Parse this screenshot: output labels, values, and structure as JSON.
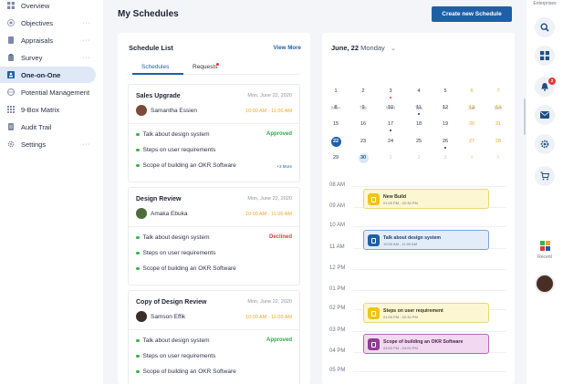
{
  "sidebar": {
    "items": [
      {
        "label": "Overview",
        "icon": "grid-icon",
        "has_menu": false
      },
      {
        "label": "Objectives",
        "icon": "target-icon",
        "has_menu": true
      },
      {
        "label": "Appraisals",
        "icon": "document-icon",
        "has_menu": true
      },
      {
        "label": "Survey",
        "icon": "clipboard-icon",
        "has_menu": true
      },
      {
        "label": "One-on-One",
        "icon": "person-card-icon",
        "has_menu": false,
        "active": true
      },
      {
        "label": "Potential Management",
        "icon": "globe-icon",
        "has_menu": false
      },
      {
        "label": "9-Box Matrix",
        "icon": "matrix-icon",
        "has_menu": false
      },
      {
        "label": "Audit Trail",
        "icon": "list-icon",
        "has_menu": false
      },
      {
        "label": "Settings",
        "icon": "gear-icon",
        "has_menu": true
      }
    ],
    "menu_glyph": "···"
  },
  "header": {
    "title": "My Schedules",
    "create_button": "Create new Schedule"
  },
  "schedule_list": {
    "title": "Schedule List",
    "view_more": "View More",
    "tabs": [
      "Schedules",
      "Requests"
    ],
    "cards": [
      {
        "title": "Sales Upgrade",
        "date": "Mon, June 22, 2020",
        "person": "Samantha Essien",
        "time": "10:00 AM - 11:00 AM",
        "points": [
          "Talk about design system",
          "Steps on user requirements",
          "Scope of building an OKR Software"
        ],
        "status": "Approved",
        "more": "+3 More"
      },
      {
        "title": "Design Review",
        "date": "Mon, June 22, 2020",
        "person": "Amaka Ebuka",
        "time": "10:00 AM - 11:00 AM",
        "points": [
          "Talk about design system",
          "Steps on user requirements",
          "Scope of building an OKR Software"
        ],
        "status": "Declined"
      },
      {
        "title": "Copy of Design Review",
        "date": "Mon, June 22, 2020",
        "person": "Samson Effik",
        "time": "10:00 AM - 11:00 AM",
        "points": [
          "Talk about design system",
          "Steps on user requirements",
          "Scope of building an OKR Software"
        ],
        "status": "Approved"
      }
    ],
    "colors": {
      "approved": "#2fa84f",
      "declined": "#e23b3b",
      "time": "#f5a524"
    }
  },
  "calendar": {
    "month_day": "June, 22",
    "weekday": "Monday",
    "weekdays": [
      "Mon",
      "Tue",
      "Wed",
      "Thu",
      "Fri",
      "Sat",
      "Sun"
    ],
    "weeks": [
      [
        "1",
        "2",
        "3",
        "4",
        "5",
        "6",
        "7"
      ],
      [
        "8",
        "9",
        "10",
        "11",
        "12",
        "13",
        "14"
      ],
      [
        "15",
        "16",
        "17",
        "18",
        "19",
        "20",
        "21"
      ],
      [
        "22",
        "23",
        "24",
        "25",
        "26",
        "27",
        "28"
      ],
      [
        "29",
        "30",
        "1",
        "2",
        "3",
        "4",
        "5"
      ]
    ],
    "selected_day": "22",
    "highlight_day": "30",
    "hours": [
      "08 AM",
      "09 AM",
      "10 AM",
      "11 AM",
      "12 PM",
      "01 PM",
      "02 PM",
      "03 PM",
      "04 PM",
      "05 PM"
    ],
    "events": [
      {
        "title": "New Build",
        "time": "01:00 PM - 02:30 PM",
        "color": "yellow"
      },
      {
        "title": "Talk about design system",
        "time": "10:00 AM - 11:00 AM",
        "color": "blue"
      },
      {
        "title": "Steps on user requirement",
        "time": "01:00 PM - 02:30 PM",
        "color": "yellow"
      },
      {
        "title": "Scope of building an OKR Software",
        "time": "03:00 PM - 04:00 PM",
        "color": "purple"
      }
    ]
  },
  "rail": {
    "top_label": "Enterprises",
    "recent_label": "Recent",
    "buttons": [
      "search-icon",
      "apps-icon",
      "bell-icon",
      "mail-icon",
      "settings-icon",
      "cart-icon"
    ],
    "notification_count": "2"
  }
}
